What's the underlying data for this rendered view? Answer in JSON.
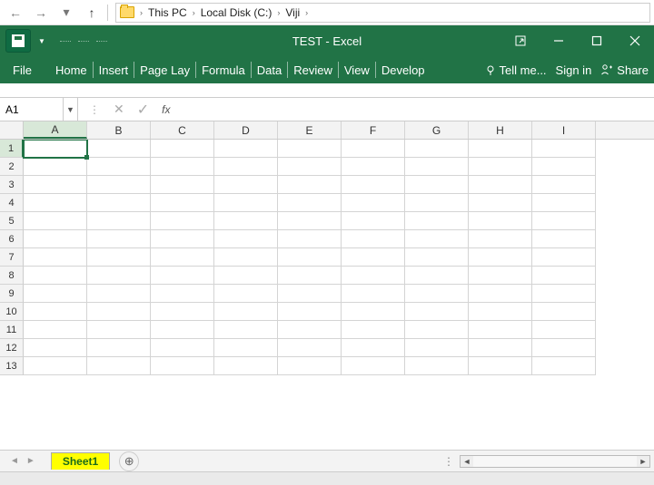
{
  "explorer": {
    "crumbs": [
      "This PC",
      "Local Disk (C:)",
      "Viji"
    ]
  },
  "title": "TEST - Excel",
  "ribbon": {
    "file": "File",
    "tabs": [
      "Home",
      "Insert",
      "Page Lay",
      "Formula",
      "Data",
      "Review",
      "View",
      "Develop"
    ],
    "tellme": "Tell me...",
    "signin": "Sign in",
    "share": "Share"
  },
  "namebox": "A1",
  "fx_label": "fx",
  "columns": [
    "A",
    "B",
    "C",
    "D",
    "E",
    "F",
    "G",
    "H",
    "I"
  ],
  "rows": [
    "1",
    "2",
    "3",
    "4",
    "5",
    "6",
    "7",
    "8",
    "9",
    "10",
    "11",
    "12",
    "13"
  ],
  "active_cell": {
    "row": 0,
    "col": 0
  },
  "sheet": {
    "name": "Sheet1"
  }
}
